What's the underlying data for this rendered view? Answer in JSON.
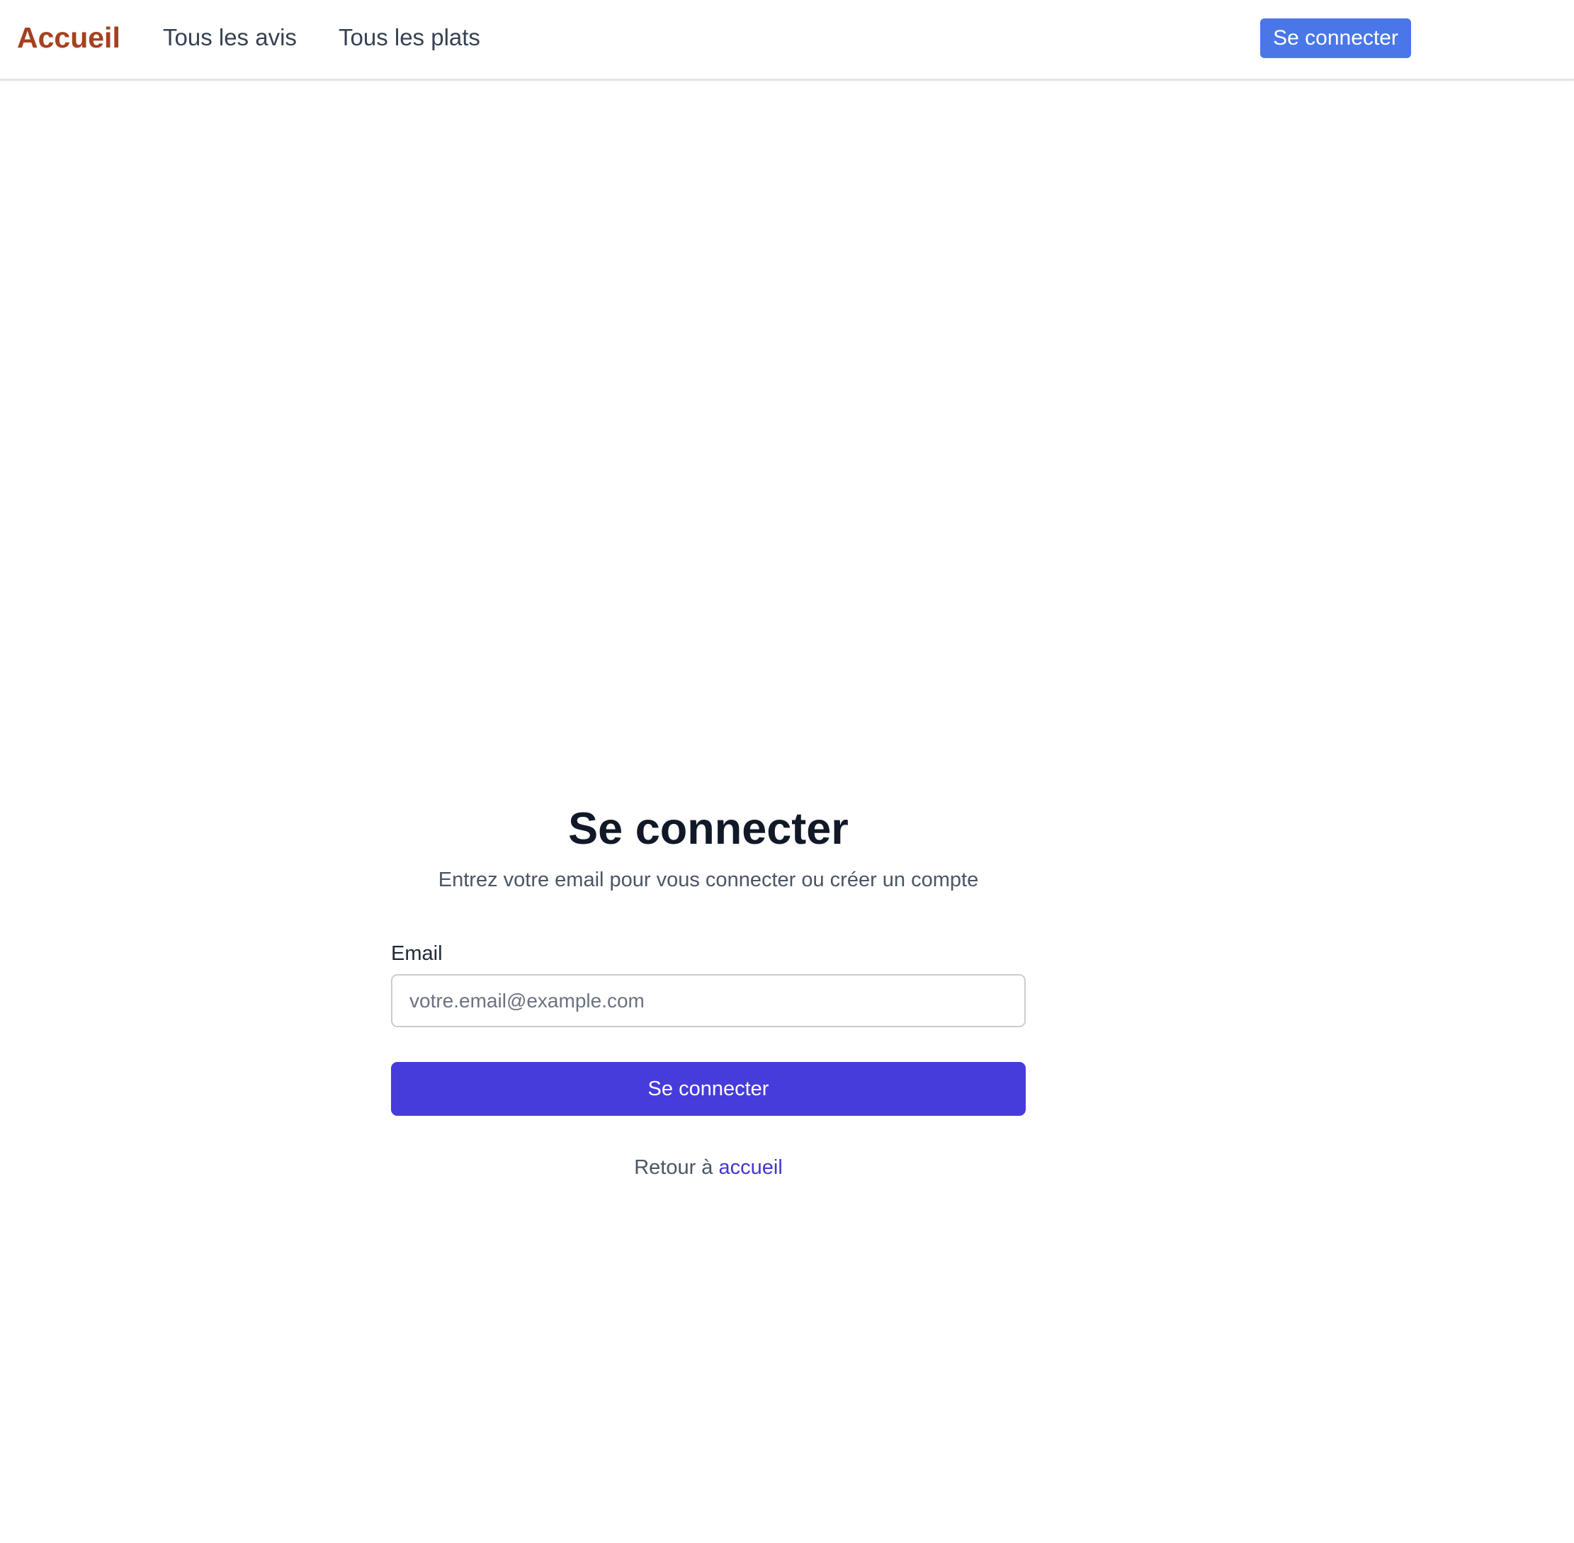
{
  "navbar": {
    "brand": "Accueil",
    "links": [
      {
        "label": "Tous les avis"
      },
      {
        "label": "Tous les plats"
      }
    ],
    "login_label": "Se connecter"
  },
  "main": {
    "title": "Se connecter",
    "subtitle": "Entrez votre email pour vous connecter ou créer un compte",
    "email_label": "Email",
    "email_value": "",
    "email_placeholder": "votre.email@example.com",
    "submit_label": "Se connecter",
    "back_prefix": "Retour à ",
    "back_link": "accueil"
  },
  "colors": {
    "brand": "#a5411f",
    "nav_button": "#4a77e8",
    "primary": "#463cdb",
    "link": "#4338ca"
  }
}
